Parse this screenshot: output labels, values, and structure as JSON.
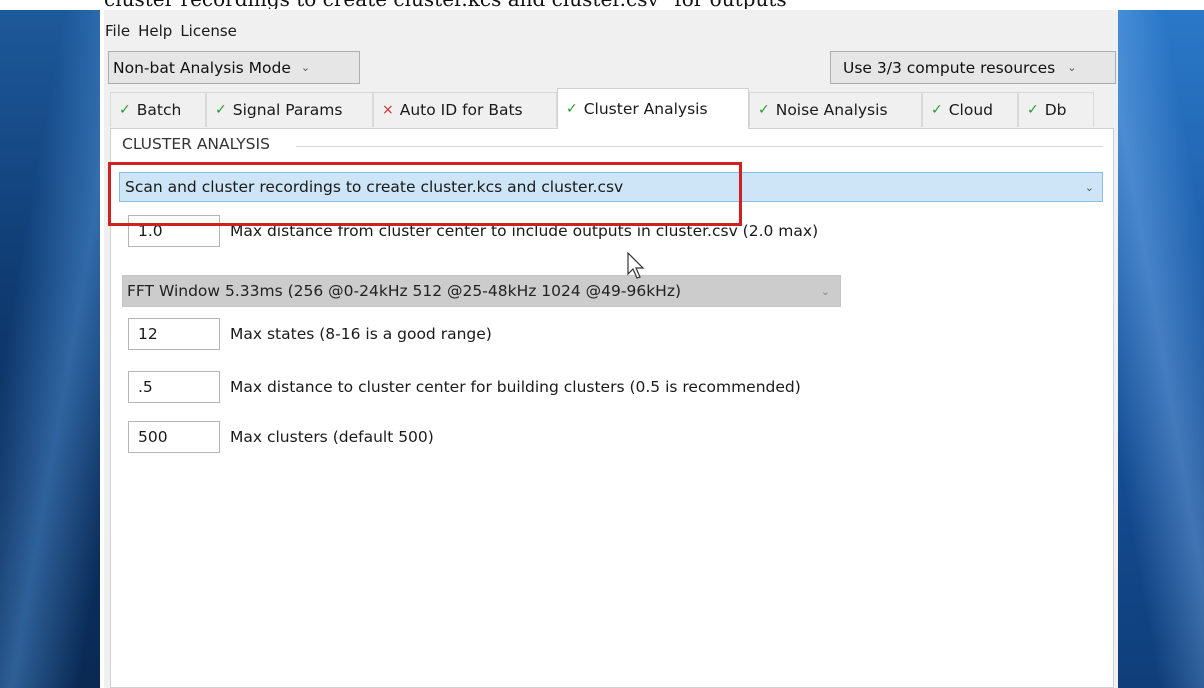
{
  "caption_text": "cluster recordings to create cluster.kcs and cluster.csv\" for outputs",
  "menu": [
    "File",
    "Help",
    "License"
  ],
  "mode_select": {
    "value": "Non-bat Analysis Mode"
  },
  "resources_select": {
    "value": "Use 3/3 compute resources"
  },
  "tabs": [
    {
      "label": "Batch",
      "status": "✓",
      "active": false
    },
    {
      "label": "Signal Params",
      "status": "✓",
      "active": false
    },
    {
      "label": "Auto ID for Bats",
      "status": "×",
      "active": false
    },
    {
      "label": "Cluster Analysis",
      "status": "✓",
      "active": true
    },
    {
      "label": "Noise Analysis",
      "status": "✓",
      "active": false
    },
    {
      "label": "Cloud",
      "status": "✓",
      "active": false
    },
    {
      "label": "Db",
      "status": "✓",
      "active": false
    }
  ],
  "panel": {
    "group_title": "CLUSTER ANALYSIS",
    "action_select": {
      "value": "Scan and cluster recordings to create cluster.kcs and cluster.csv"
    },
    "fields": [
      {
        "value": "1.0",
        "label": "Max distance from cluster center to include outputs in cluster.csv (2.0 max)"
      },
      {
        "value": "12",
        "label": "Max states (8-16 is a good range)"
      },
      {
        "value": ".5",
        "label": "Max distance to cluster center for building clusters (0.5 is recommended)"
      },
      {
        "value": "500",
        "label": "Max clusters (default 500)"
      }
    ],
    "fft_select": {
      "value": "FFT Window  5.33ms (256 @0-24kHz  512 @25-48kHz 1024 @49-96kHz)"
    }
  },
  "colors": {
    "check": "#2e9a2e",
    "cross": "#d03030",
    "highlight_box": "#d02020",
    "selected_combo": "#cde5f7"
  },
  "icons": {
    "check": "check-icon",
    "cross": "cross-icon",
    "dropdown": "chevron-down-icon",
    "cursor": "mouse-pointer-icon"
  }
}
